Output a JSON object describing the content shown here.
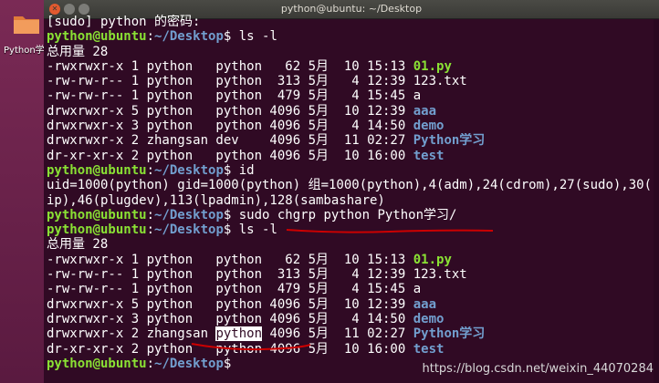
{
  "desktop": {
    "folder_label": "Python学习"
  },
  "window": {
    "title": "python@ubuntu: ~/Desktop"
  },
  "terminal": {
    "lines": [
      [
        {
          "t": "[sudo] python 的密码:"
        }
      ],
      [
        {
          "t": "python@ubuntu",
          "c": "prompt-user"
        },
        {
          "t": ":"
        },
        {
          "t": "~/Desktop",
          "c": "prompt-path"
        },
        {
          "t": "$ ls -l"
        }
      ],
      [
        {
          "t": "总用量 28"
        }
      ],
      [
        {
          "t": "-rwxrwxr-x 1 python   python   62 5月  10 15:13 "
        },
        {
          "t": "01.py",
          "c": "exec"
        }
      ],
      [
        {
          "t": "-rw-rw-r-- 1 python   python  313 5月   4 12:39 123.txt"
        }
      ],
      [
        {
          "t": "-rw-rw-r-- 1 python   python  479 5月   4 15:45 a"
        }
      ],
      [
        {
          "t": "drwxrwxr-x 5 python   python 4096 5月  10 12:39 "
        },
        {
          "t": "aaa",
          "c": "dir"
        }
      ],
      [
        {
          "t": "drwxrwxr-x 3 python   python 4096 5月   4 14:50 "
        },
        {
          "t": "demo",
          "c": "dir"
        }
      ],
      [
        {
          "t": "drwxrwxr-x 2 zhangsan dev    4096 5月  11 02:27 "
        },
        {
          "t": "Python学习",
          "c": "dir"
        }
      ],
      [
        {
          "t": "dr-xr-xr-x 2 python   python 4096 5月  10 16:00 "
        },
        {
          "t": "test",
          "c": "dir"
        }
      ],
      [
        {
          "t": "python@ubuntu",
          "c": "prompt-user"
        },
        {
          "t": ":"
        },
        {
          "t": "~/Desktop",
          "c": "prompt-path"
        },
        {
          "t": "$ id"
        }
      ],
      [
        {
          "t": "uid=1000(python) gid=1000(python) 组=1000(python),4(adm),24(cdrom),27(sudo),30("
        }
      ],
      [
        {
          "t": "ip),46(plugdev),113(lpadmin),128(sambashare)"
        }
      ],
      [
        {
          "t": "python@ubuntu",
          "c": "prompt-user"
        },
        {
          "t": ":"
        },
        {
          "t": "~/Desktop",
          "c": "prompt-path"
        },
        {
          "t": "$ sudo chgrp python Python学习/"
        }
      ],
      [
        {
          "t": "python@ubuntu",
          "c": "prompt-user"
        },
        {
          "t": ":"
        },
        {
          "t": "~/Desktop",
          "c": "prompt-path"
        },
        {
          "t": "$ ls -l"
        }
      ],
      [
        {
          "t": "总用量 28"
        }
      ],
      [
        {
          "t": "-rwxrwxr-x 1 python   python   62 5月  10 15:13 "
        },
        {
          "t": "01.py",
          "c": "exec"
        }
      ],
      [
        {
          "t": "-rw-rw-r-- 1 python   python  313 5月   4 12:39 123.txt"
        }
      ],
      [
        {
          "t": "-rw-rw-r-- 1 python   python  479 5月   4 15:45 a"
        }
      ],
      [
        {
          "t": "drwxrwxr-x 5 python   python 4096 5月  10 12:39 "
        },
        {
          "t": "aaa",
          "c": "dir"
        }
      ],
      [
        {
          "t": "drwxrwxr-x 3 python   python 4096 5月   4 14:50 "
        },
        {
          "t": "demo",
          "c": "dir"
        }
      ],
      [
        {
          "t": "drwxrwxr-x 2 zhangsan "
        },
        {
          "t": "python",
          "c": "hl"
        },
        {
          "t": " 4096 5月  11 02:27 "
        },
        {
          "t": "Python学习",
          "c": "dir"
        }
      ],
      [
        {
          "t": "dr-xr-xr-x 2 python   python 4096 5月  10 16:00 "
        },
        {
          "t": "test",
          "c": "dir"
        }
      ],
      [
        {
          "t": "python@ubuntu",
          "c": "prompt-user"
        },
        {
          "t": ":"
        },
        {
          "t": "~/Desktop",
          "c": "prompt-path"
        },
        {
          "t": "$ "
        }
      ]
    ]
  },
  "watermark": "https://blog.csdn.net/weixin_44070284",
  "colors": {
    "background": "#300a24",
    "prompt_user": "#8ae234",
    "prompt_path": "#729fcf",
    "directory": "#729fcf",
    "annotation": "#cc0000"
  }
}
